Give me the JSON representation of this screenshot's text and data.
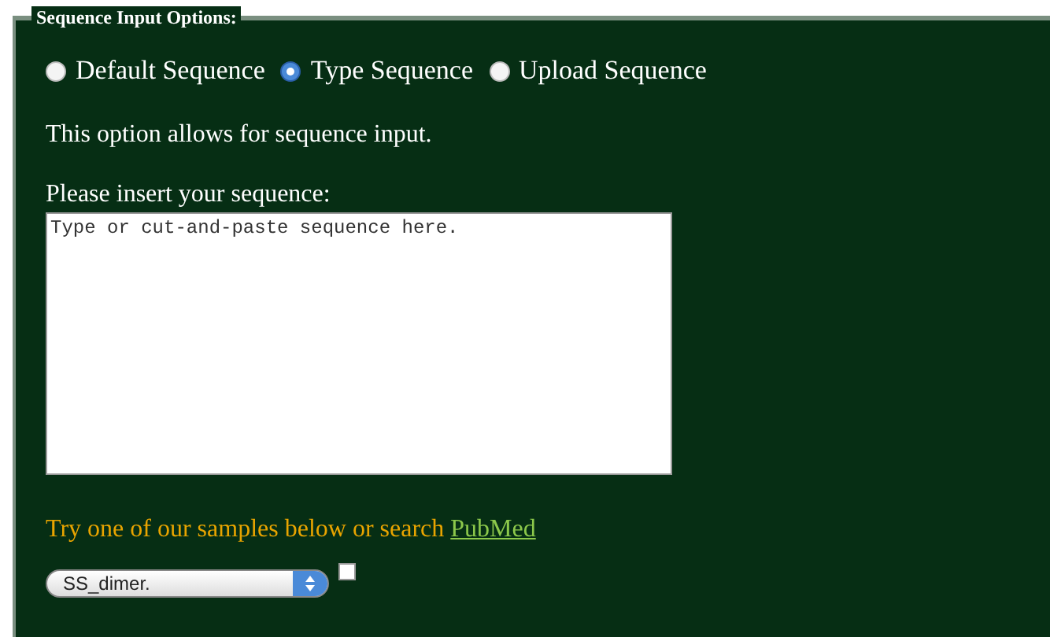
{
  "fieldset": {
    "legend": "Sequence Input Options:",
    "options": [
      {
        "label": "Default Sequence",
        "selected": false
      },
      {
        "label": "Type Sequence",
        "selected": true
      },
      {
        "label": "Upload Sequence",
        "selected": false
      }
    ],
    "description": "This option allows for sequence input.",
    "prompt": "Please insert your sequence:",
    "sequence": {
      "placeholder": "Type or cut-and-paste sequence here."
    },
    "samples_text": "Try one of our samples below or search",
    "samples_link": "PubMed",
    "sample_select": {
      "value": "SS_dimer."
    }
  }
}
